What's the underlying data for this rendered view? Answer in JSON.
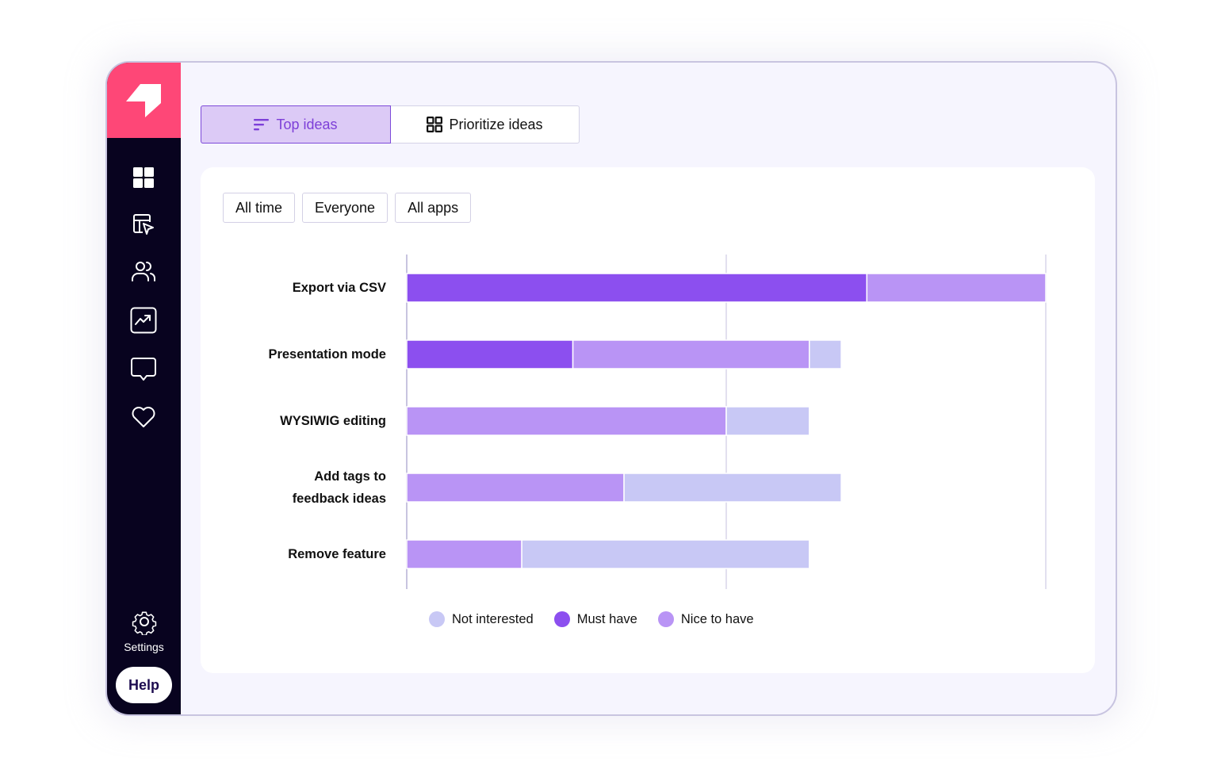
{
  "sidebar": {
    "logo": "brand-logo",
    "items": [
      {
        "name": "dashboard",
        "icon": "grid-icon"
      },
      {
        "name": "board",
        "icon": "layout-cursor-icon"
      },
      {
        "name": "users",
        "icon": "users-icon"
      },
      {
        "name": "analytics",
        "icon": "trend-chart-icon"
      },
      {
        "name": "feedback",
        "icon": "message-icon"
      },
      {
        "name": "favorites",
        "icon": "heart-icon"
      }
    ],
    "settings_label": "Settings",
    "help_label": "Help"
  },
  "tabs": [
    {
      "label": "Top ideas",
      "icon": "sort-lines-icon",
      "active": true
    },
    {
      "label": "Prioritize ideas",
      "icon": "grid-outline-icon",
      "active": false
    }
  ],
  "filters": [
    {
      "label": "All time"
    },
    {
      "label": "Everyone"
    },
    {
      "label": "All apps"
    }
  ],
  "colors": {
    "brand": "#fe4777",
    "sidebar_bg": "#08031f",
    "must_have": "#8c4fef",
    "nice_to_have": "#b994f5",
    "not_interested": "#c8c8f5"
  },
  "chart_data": {
    "type": "bar",
    "orientation": "horizontal",
    "stacked": true,
    "categories": [
      "Export via CSV",
      "Presentation mode",
      "WYSIWIG editing",
      "Add tags to feedback ideas",
      "Remove feature"
    ],
    "category_lines": [
      [
        "Export via CSV"
      ],
      [
        "Presentation mode"
      ],
      [
        "WYSIWIG editing"
      ],
      [
        "Add tags to",
        "feedback ideas"
      ],
      [
        "Remove feature"
      ]
    ],
    "series": [
      {
        "name": "Must have",
        "color": "#8c4fef",
        "values": [
          72,
          26,
          0,
          0,
          0
        ]
      },
      {
        "name": "Nice to have",
        "color": "#b994f5",
        "values": [
          28,
          37,
          50,
          34,
          18
        ]
      },
      {
        "name": "Not interested",
        "color": "#c8c8f5",
        "values": [
          0,
          5,
          13,
          34,
          45
        ]
      }
    ],
    "legend": [
      "Not interested",
      "Must have",
      "Nice to have"
    ],
    "legend_order_series": [
      2,
      0,
      1
    ],
    "xlim": [
      0,
      100
    ],
    "gridlines": [
      0,
      50,
      100
    ],
    "title": "",
    "xlabel": "",
    "ylabel": "",
    "legend_position": "bottom"
  }
}
